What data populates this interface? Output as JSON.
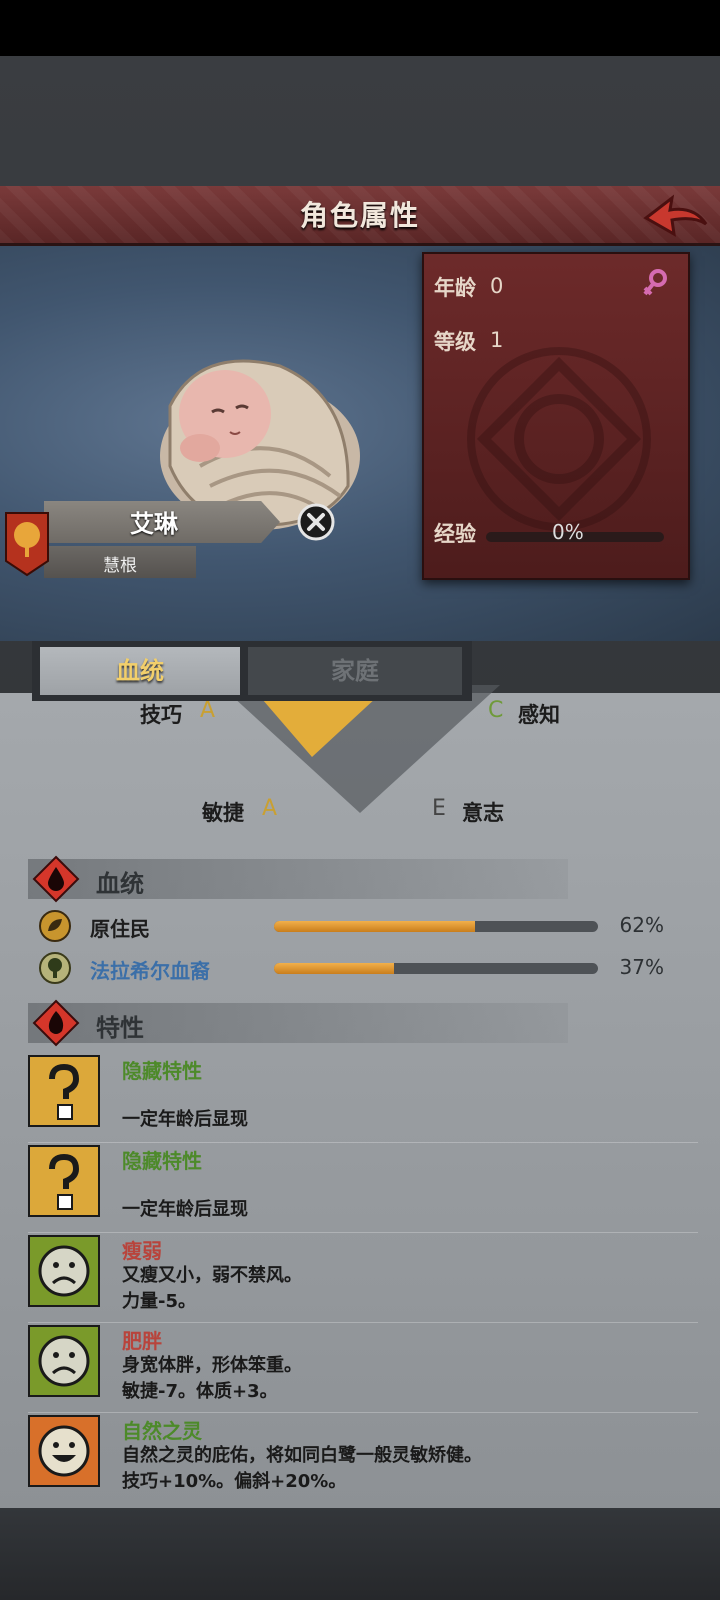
{
  "header": {
    "title": "角色属性"
  },
  "character": {
    "name": "艾琳",
    "subname": "慧根"
  },
  "stats": {
    "age_label": "年龄",
    "age_value": "0",
    "level_label": "等级",
    "level_value": "1",
    "exp_label": "经验",
    "exp_value": "0%",
    "exp_progress": 0
  },
  "tabs": [
    {
      "label": "血统",
      "active": true
    },
    {
      "label": "家庭",
      "active": false
    }
  ],
  "attributes": {
    "skill_label": "技巧",
    "skill_grade": "A",
    "perception_label": "感知",
    "perception_grade": "C",
    "agility_label": "敏捷",
    "agility_grade": "A",
    "will_label": "意志",
    "will_grade": "E"
  },
  "bloodline": {
    "title": "血统",
    "entries": [
      {
        "name": "原住民",
        "percent": "62%",
        "value": 0.62,
        "color": "#1d1d1d"
      },
      {
        "name": "法拉希尔血裔",
        "percent": "37%",
        "value": 0.37,
        "color": "#3b6fa8"
      }
    ]
  },
  "traits": {
    "title": "特性",
    "items": [
      {
        "name": "隐藏特性",
        "name_color": "#4d8a2a",
        "line1": "",
        "line2": "一定年龄后显现",
        "icon": "question-icon"
      },
      {
        "name": "隐藏特性",
        "name_color": "#4d8a2a",
        "line1": "",
        "line2": "一定年龄后显现",
        "icon": "question-icon"
      },
      {
        "name": "瘦弱",
        "name_color": "#b8443c",
        "line1": "又瘦又小，弱不禁风。",
        "line2": "力量-5。",
        "icon": "sad-face-icon"
      },
      {
        "name": "肥胖",
        "name_color": "#b8443c",
        "line1": "身宽体胖，形体笨重。",
        "line2": "敏捷-7。体质+3。",
        "icon": "sad-face-icon"
      },
      {
        "name": "自然之灵",
        "name_color": "#4d8a2a",
        "line1": "自然之灵的庇佑，将如同白鹭一般灵敏矫健。",
        "line2": "技巧+10%。偏斜+20%。",
        "icon": "happy-face-icon"
      }
    ]
  },
  "colors": {
    "accent_gold": "#f2cf6b",
    "header_red": "#7a3a3a",
    "bar_orange": "#f2b04a"
  }
}
